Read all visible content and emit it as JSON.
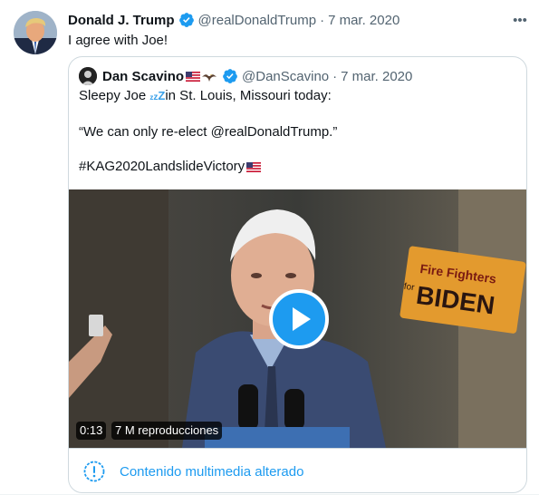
{
  "tweet": {
    "author_name": "Donald J. Trump",
    "author_handle": "@realDonaldTrump",
    "separator": "·",
    "date": "7 mar. 2020",
    "more_label": "•••",
    "text": "I agree with Joe!",
    "verified": true,
    "avatar_icon": "user-avatar-icon"
  },
  "quote": {
    "author_name": "Dan Scavino",
    "author_handle": "@DanScavino",
    "separator": "·",
    "date": "7 mar. 2020",
    "line1_before": "Sleepy Joe ",
    "zzz": [
      "z",
      "z",
      "Z"
    ],
    "line1_after": "in St. Louis, Missouri today:",
    "line2": "“We can only re-elect @realDonaldTrump.”",
    "line3": "#KAG2020LandslideVictory",
    "video": {
      "duration": "0:13",
      "views": "7 M reproducciones",
      "sign_line1": "Fire Fighters",
      "sign_line2": "BIDEN",
      "sign_for": "for"
    },
    "media_warning": "Contenido multimedia alterado"
  },
  "colors": {
    "accent": "#1d9bf0",
    "secondary_text": "#536471",
    "border": "#cfd9de"
  }
}
